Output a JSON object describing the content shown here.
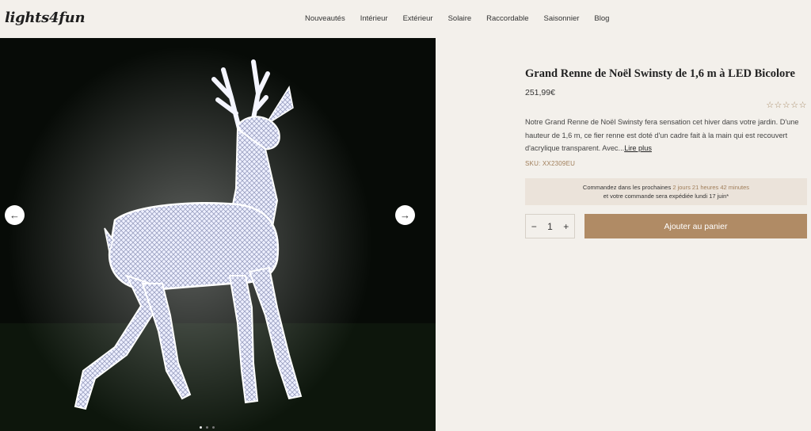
{
  "header": {
    "logo": "lights4fun",
    "nav": [
      "Nouveautés",
      "Intérieur",
      "Extérieur",
      "Solaire",
      "Raccordable",
      "Saisonnier",
      "Blog"
    ]
  },
  "gallery": {
    "prev_icon": "arrow-left-icon",
    "next_icon": "arrow-right-icon",
    "dots_total": 3,
    "dots_active": 1
  },
  "product": {
    "title": "Grand Renne de Noël Swinsty de 1,6 m à LED Bicolore",
    "price": "251,99€",
    "rating_stars": "☆☆☆☆☆",
    "description": "Notre Grand Renne de Noël Swinsty fera sensation cet hiver dans votre jardin. D'une hauteur de 1,6 m, ce fier renne est doté d'un cadre fait à la main qui est recouvert d'acrylique transparent. Avec...",
    "read_more": "Lire plus",
    "sku": "SKU: XX2309EU",
    "notice_prefix": "Commandez dans les prochaines ",
    "notice_time": "2 jours 21 heures 42 minutes",
    "notice_line2": "et votre commande sera expédiée lundi 17 juin*",
    "quantity": "1",
    "qty_minus": "−",
    "qty_plus": "+",
    "add_to_cart": "Ajouter au panier"
  },
  "colors": {
    "accent": "#b08b65",
    "background": "#f3f0eb",
    "notice_bg": "#ebe3da"
  }
}
